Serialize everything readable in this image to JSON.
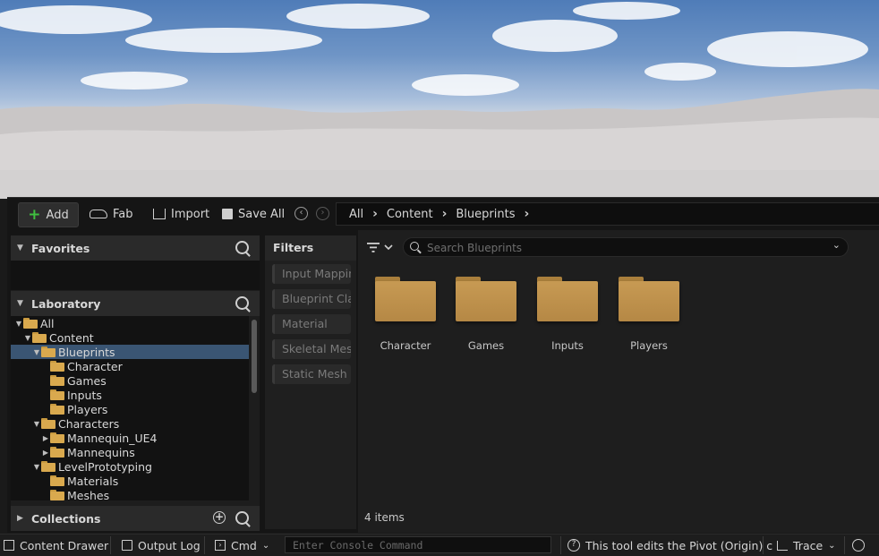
{
  "toolbar": {
    "add_label": "Add",
    "fab_label": "Fab",
    "import_label": "Import",
    "save_all_label": "Save All"
  },
  "breadcrumb": [
    "All",
    "Content",
    "Blueprints"
  ],
  "left_panel": {
    "favorites_title": "Favorites",
    "laboratory_title": "Laboratory",
    "collections_title": "Collections",
    "tree": [
      {
        "label": "All",
        "depth": 0,
        "expanded": true
      },
      {
        "label": "Content",
        "depth": 1,
        "expanded": true
      },
      {
        "label": "Blueprints",
        "depth": 2,
        "expanded": true,
        "selected": true
      },
      {
        "label": "Character",
        "depth": 3
      },
      {
        "label": "Games",
        "depth": 3
      },
      {
        "label": "Inputs",
        "depth": 3
      },
      {
        "label": "Players",
        "depth": 3
      },
      {
        "label": "Characters",
        "depth": 2,
        "expanded": true
      },
      {
        "label": "Mannequin_UE4",
        "depth": 3,
        "collapsed": true
      },
      {
        "label": "Mannequins",
        "depth": 3,
        "collapsed": true
      },
      {
        "label": "LevelPrototyping",
        "depth": 2,
        "expanded": true
      },
      {
        "label": "Materials",
        "depth": 3
      },
      {
        "label": "Meshes",
        "depth": 3
      }
    ]
  },
  "filters": {
    "title": "Filters",
    "items": [
      "Input Mappin",
      "Blueprint Cla",
      "Material",
      "Skeletal Mes",
      "Static Mesh"
    ]
  },
  "content": {
    "search_placeholder": "Search Blueprints",
    "folders": [
      "Character",
      "Games",
      "Inputs",
      "Players"
    ],
    "item_count": "4 items"
  },
  "status_bar": {
    "content_drawer": "Content Drawer",
    "output_log": "Output Log",
    "cmd": "Cmd",
    "console_placeholder": "Enter Console Command",
    "hint": "This tool edits the Pivot (Origin) c",
    "trace": "Trace"
  },
  "colors": {
    "folder": "#c79a53",
    "selection": "#3a5573",
    "add_plus": "#3fbf3f"
  }
}
